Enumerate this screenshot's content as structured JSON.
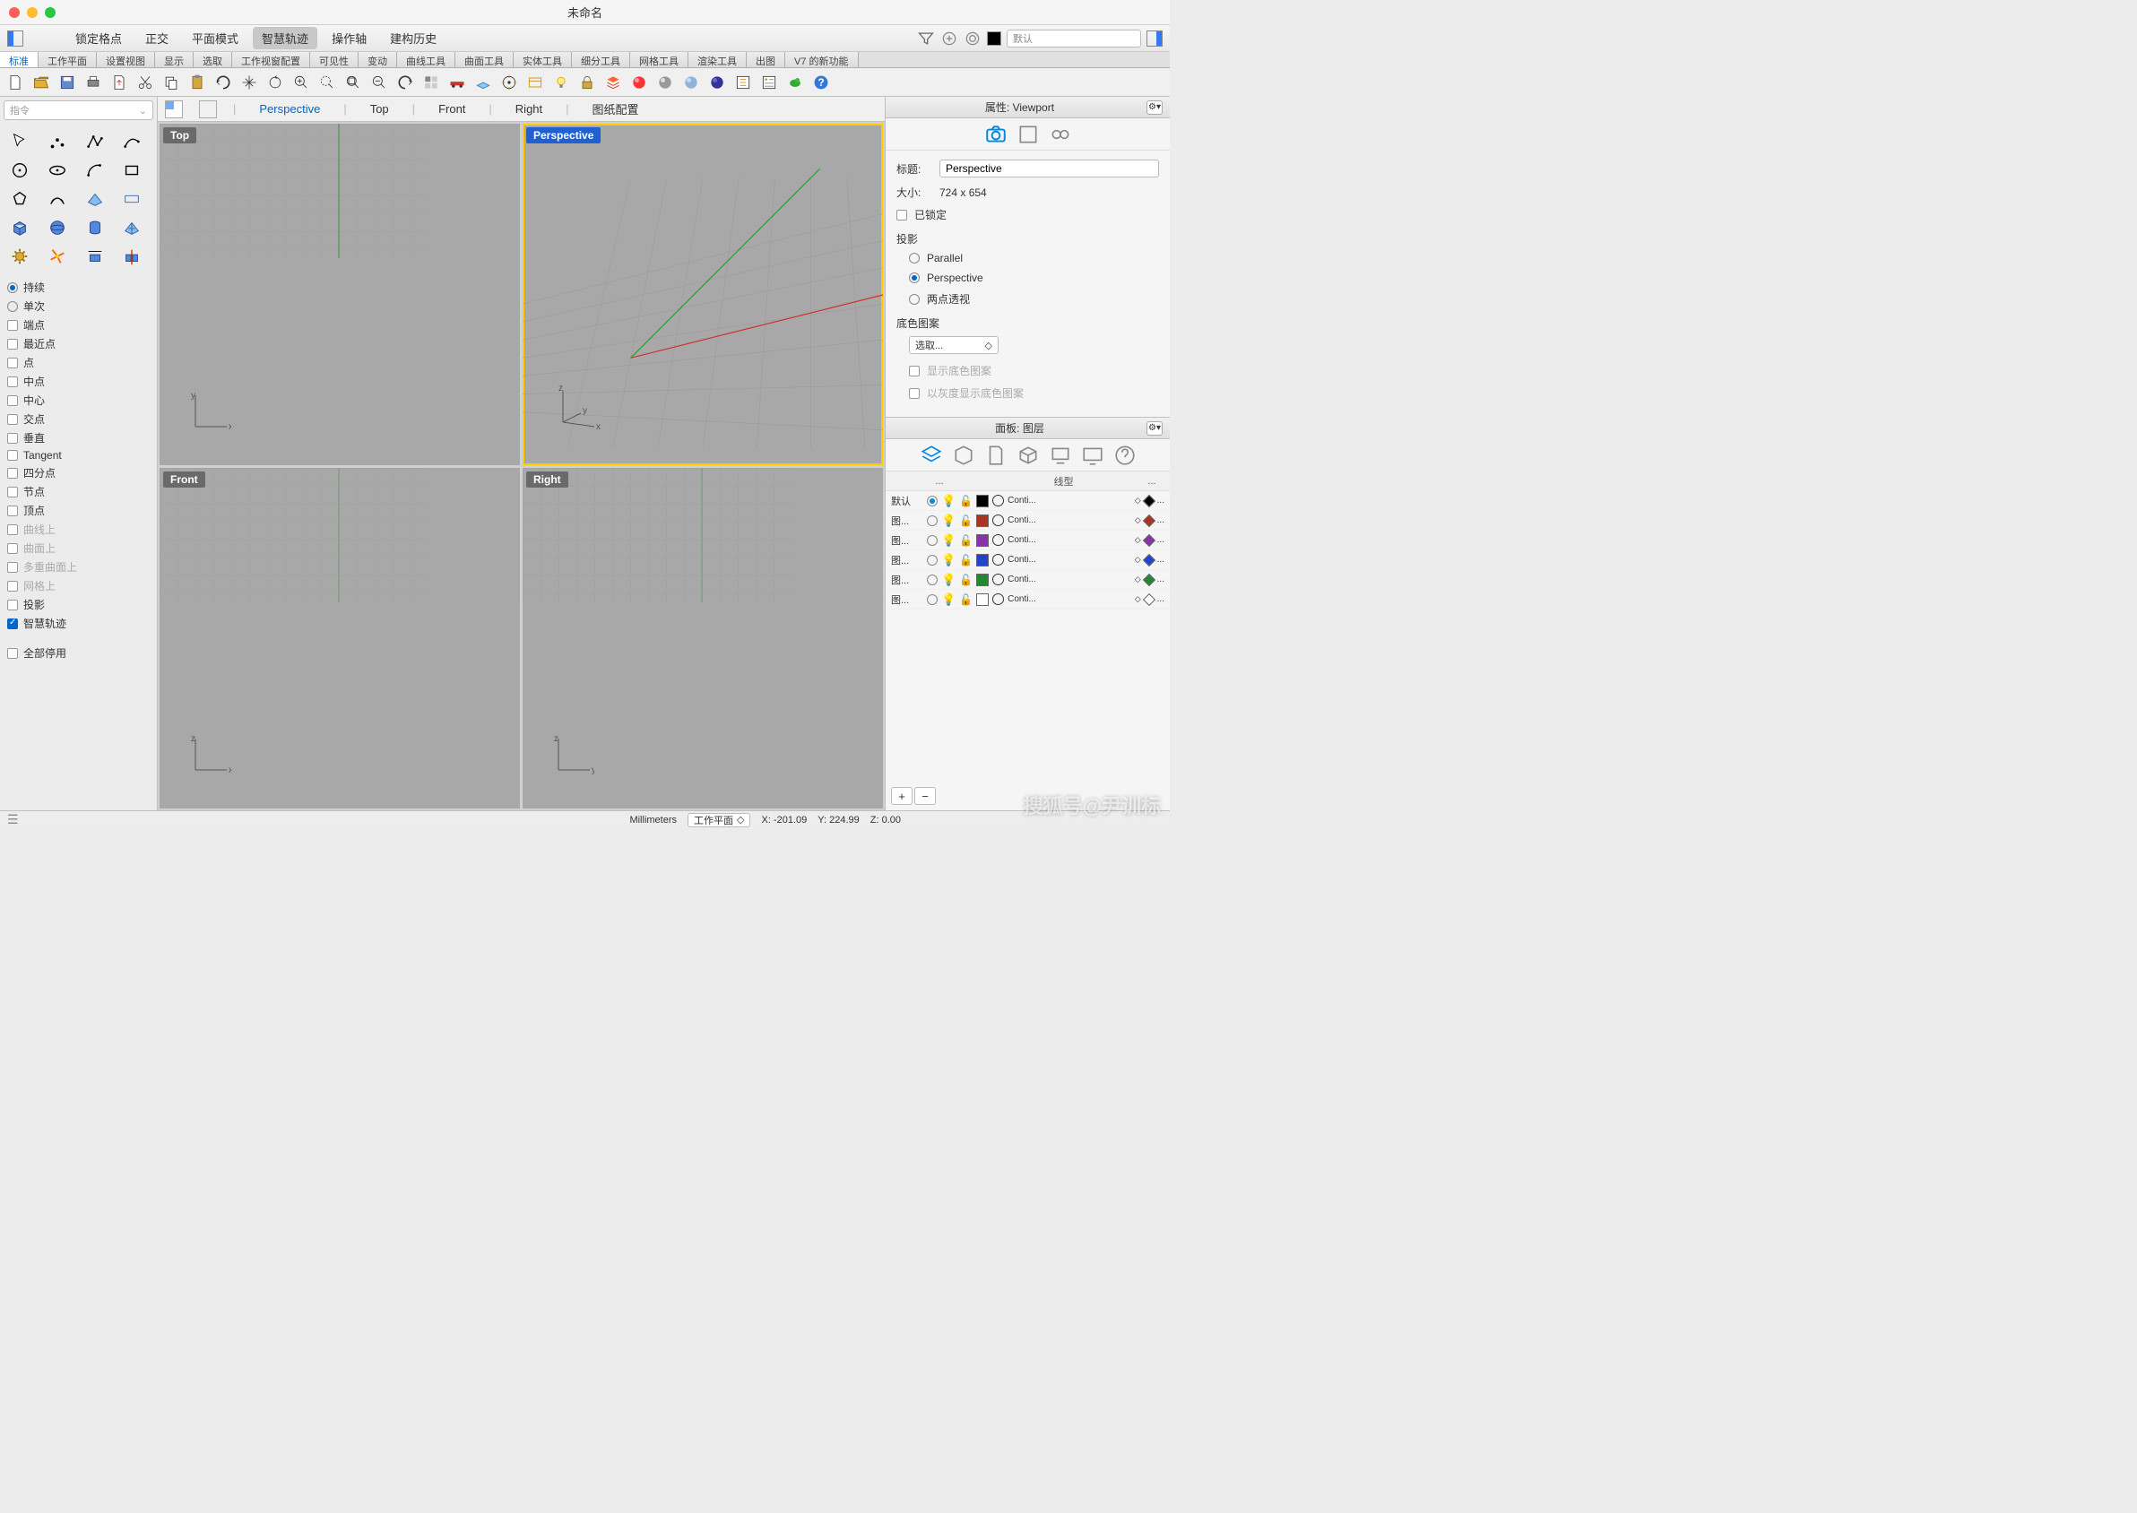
{
  "window": {
    "title": "未命名"
  },
  "top_toolbar": {
    "items": [
      "锁定格点",
      "正交",
      "平面模式",
      "智慧轨迹",
      "操作轴",
      "建构历史"
    ],
    "active_index": 3,
    "layer_dropdown": "默认"
  },
  "menu_tabs": [
    "标准",
    "工作平面",
    "设置视图",
    "显示",
    "选取",
    "工作视窗配置",
    "可见性",
    "变动",
    "曲线工具",
    "曲面工具",
    "实体工具",
    "细分工具",
    "网格工具",
    "渲染工具",
    "出图",
    "V7 的新功能"
  ],
  "menu_active": 0,
  "command": {
    "placeholder": "指令"
  },
  "osnap": {
    "mode": {
      "persist": "持续",
      "once": "单次",
      "active": "persist"
    },
    "items": [
      {
        "label": "端点",
        "on": false,
        "enabled": true
      },
      {
        "label": "最近点",
        "on": false,
        "enabled": true
      },
      {
        "label": "点",
        "on": false,
        "enabled": true
      },
      {
        "label": "中点",
        "on": false,
        "enabled": true
      },
      {
        "label": "中心",
        "on": false,
        "enabled": true
      },
      {
        "label": "交点",
        "on": false,
        "enabled": true
      },
      {
        "label": "垂直",
        "on": false,
        "enabled": true
      },
      {
        "label": "Tangent",
        "on": false,
        "enabled": true
      },
      {
        "label": "四分点",
        "on": false,
        "enabled": true
      },
      {
        "label": "节点",
        "on": false,
        "enabled": true
      },
      {
        "label": "顶点",
        "on": false,
        "enabled": true
      },
      {
        "label": "曲线上",
        "on": false,
        "enabled": false
      },
      {
        "label": "曲面上",
        "on": false,
        "enabled": false
      },
      {
        "label": "多重曲面上",
        "on": false,
        "enabled": false
      },
      {
        "label": "网格上",
        "on": false,
        "enabled": false
      },
      {
        "label": "投影",
        "on": false,
        "enabled": true
      },
      {
        "label": "智慧轨迹",
        "on": true,
        "enabled": true
      }
    ],
    "disable_all": "全部停用"
  },
  "viewport_tabs": [
    "Perspective",
    "Top",
    "Front",
    "Right",
    "图纸配置"
  ],
  "viewports": {
    "top_left": "Top",
    "top_right": "Perspective",
    "bottom_left": "Front",
    "bottom_right": "Right",
    "active": "top_right"
  },
  "properties": {
    "title": "属性: Viewport",
    "field_title_label": "标题:",
    "field_title_value": "Perspective",
    "field_size_label": "大小:",
    "field_size_value": "724 x 654",
    "locked_label": "已锁定",
    "projection": {
      "header": "投影",
      "options": [
        "Parallel",
        "Perspective",
        "两点透视"
      ],
      "active": 1
    },
    "wallpaper": {
      "header": "底色图案",
      "select_label": "选取...",
      "show_label": "显示底色图案",
      "gray_label": "以灰度显示底色图案"
    }
  },
  "layers": {
    "title": "面板: 图层",
    "headers": {
      "dots": "...",
      "linetype": "线型"
    },
    "rows": [
      {
        "name": "默认",
        "current": true,
        "on": true,
        "color": "#000000",
        "mat": "#000000",
        "lt": "Conti..."
      },
      {
        "name": "图...",
        "current": false,
        "on": true,
        "color": "#aa3322",
        "mat": "#aa3322",
        "lt": "Conti..."
      },
      {
        "name": "图...",
        "current": false,
        "on": true,
        "color": "#8833aa",
        "mat": "#8833aa",
        "lt": "Conti..."
      },
      {
        "name": "图...",
        "current": false,
        "on": true,
        "color": "#2244cc",
        "mat": "#2244cc",
        "lt": "Conti..."
      },
      {
        "name": "图...",
        "current": false,
        "on": true,
        "color": "#228833",
        "mat": "#228833",
        "lt": "Conti..."
      },
      {
        "name": "图...",
        "current": false,
        "on": true,
        "color": "#ffffff",
        "mat": "#ffffff",
        "lt": "Conti..."
      }
    ]
  },
  "statusbar": {
    "units": "Millimeters",
    "cplane": "工作平面",
    "x": "X: -201.09",
    "y": "Y: 224.99",
    "z": "Z: 0.00"
  },
  "watermark": "搜狐号@尹训标"
}
